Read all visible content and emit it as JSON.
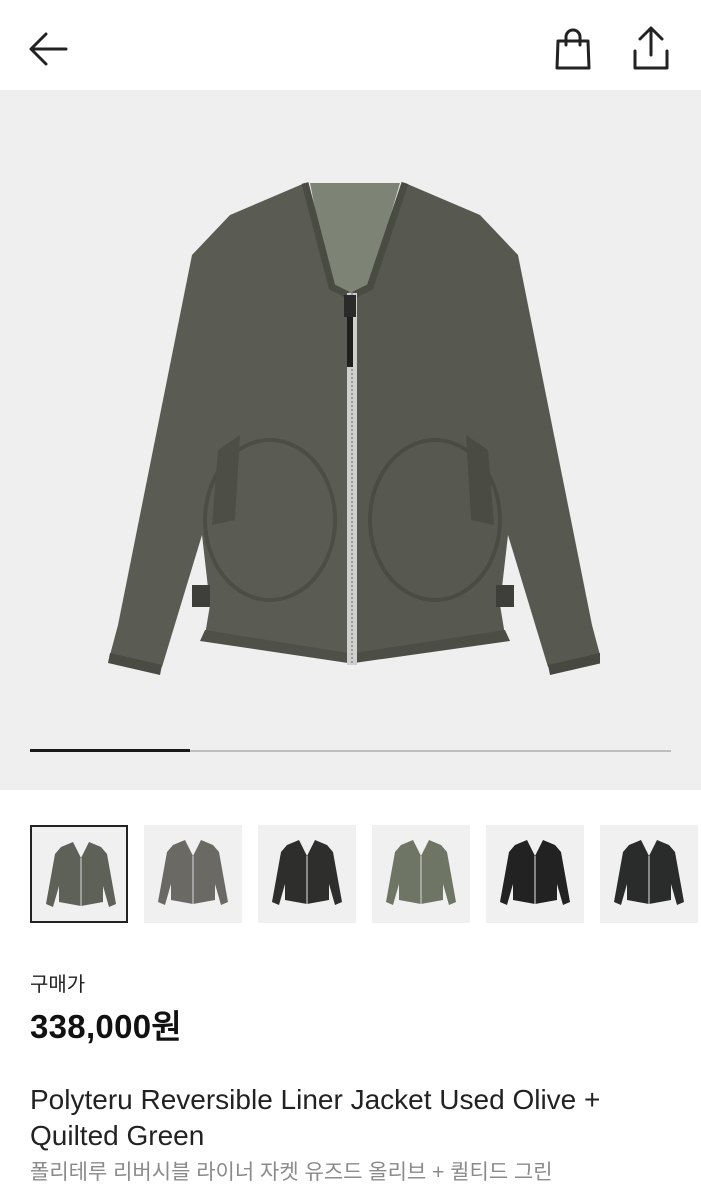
{
  "header": {
    "back_icon": "arrow-left-icon",
    "bag_icon": "shopping-bag-icon",
    "share_icon": "share-upload-icon"
  },
  "gallery": {
    "progress_fraction": 0.25,
    "main_image": "olive-jacket-front",
    "thumbnails": [
      {
        "name": "olive-jacket-front",
        "color": "#5e6157",
        "selected": true
      },
      {
        "name": "gray-jacket",
        "color": "#6a6964",
        "selected": false
      },
      {
        "name": "black-jacket",
        "color": "#2e2f2d",
        "selected": false
      },
      {
        "name": "olive-quilted-jacket",
        "color": "#6f7565",
        "selected": false
      },
      {
        "name": "black-quilted-jacket",
        "color": "#222222",
        "selected": false
      },
      {
        "name": "charcoal-jacket",
        "color": "#2a2b2b",
        "selected": false
      }
    ]
  },
  "product": {
    "price_label": "구매가",
    "price": "338,000원",
    "title_en": "Polyteru Reversible Liner Jacket Used Olive + Quilted Green",
    "title_ko": "폴리테루 리버시블 라이너 자켓 유즈드 올리브 + 퀼티드 그린"
  },
  "colors": {
    "jacket_main": "#5a5c53",
    "jacket_shadow": "#4a4c44",
    "hero_bg": "#efefef",
    "progress_fill": "#1a1a1a",
    "progress_track": "#bdbdbd"
  }
}
